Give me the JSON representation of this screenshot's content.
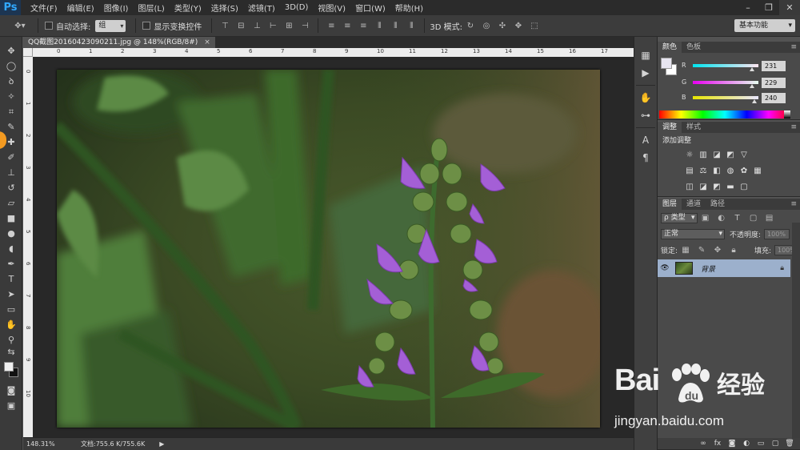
{
  "app": {
    "logo": "Ps"
  },
  "menu": [
    "文件(F)",
    "编辑(E)",
    "图像(I)",
    "图层(L)",
    "类型(Y)",
    "选择(S)",
    "滤镜(T)",
    "3D(D)",
    "视图(V)",
    "窗口(W)",
    "帮助(H)"
  ],
  "window_buttons": {
    "minimize": "–",
    "restore": "❐",
    "close": "✕"
  },
  "options": {
    "auto_select_label": "自动选择:",
    "auto_select_value": "组",
    "show_transform_label": "显示变换控件",
    "mode_3d_label": "3D 模式:",
    "workspace": "基本功能"
  },
  "document": {
    "tab_title": "QQ截图20160423090211.jpg @ 148%(RGB/8#)",
    "close": "×"
  },
  "ruler_top_ticks": [
    "0",
    "1",
    "2",
    "3",
    "4",
    "5",
    "6",
    "7",
    "8",
    "9",
    "10",
    "11",
    "12",
    "13",
    "14",
    "15",
    "16",
    "17"
  ],
  "ruler_left_ticks": [
    "0",
    "1",
    "2",
    "3",
    "4",
    "5",
    "6",
    "7",
    "8",
    "9",
    "10"
  ],
  "status": {
    "zoom": "148.31%",
    "doc_size": "文档:755.6 K/755.6K",
    "arrow": "▶"
  },
  "color_panel": {
    "tabs": [
      "颜色",
      "色板"
    ],
    "sliders": [
      {
        "label": "R",
        "value": "231",
        "fraction": 0.906,
        "gradient": "linear-gradient(to right,#00e5f0,#ffe5f0)"
      },
      {
        "label": "G",
        "value": "229",
        "fraction": 0.898,
        "gradient": "linear-gradient(to right,#e700f0,#e7fff0)"
      },
      {
        "label": "B",
        "value": "240",
        "fraction": 0.941,
        "gradient": "linear-gradient(to right,#e7e500,#e7e5ff)"
      }
    ]
  },
  "adjustments_panel": {
    "tabs": [
      "调整",
      "样式"
    ],
    "title": "添加调整"
  },
  "layers_panel": {
    "tabs": [
      "图层",
      "通道",
      "路径"
    ],
    "filter_kind": "ρ 类型",
    "blend_mode": "正常",
    "opacity_label": "不透明度:",
    "opacity_value": "100%",
    "lock_label": "锁定:",
    "fill_label": "填充:",
    "fill_value": "100%",
    "layer_name": "背景"
  },
  "watermark": {
    "brand": "Bai",
    "brand2": "经验",
    "url": "jingyan.baidu.com"
  }
}
